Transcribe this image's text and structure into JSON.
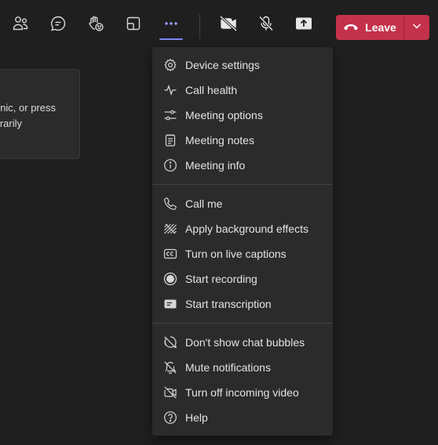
{
  "toolbar": {
    "buttons": [
      {
        "name": "people-icon"
      },
      {
        "name": "chat-icon"
      },
      {
        "name": "raise-hand-icon"
      },
      {
        "name": "view-icon"
      },
      {
        "name": "more-actions-icon",
        "active": true
      },
      {
        "name": "camera-off-icon"
      },
      {
        "name": "mic-off-icon"
      },
      {
        "name": "share-tray-icon"
      }
    ],
    "leave_label": "Leave",
    "accent_color": "#7f85f5",
    "leave_color": "#c4314b"
  },
  "notice": {
    "line1": "nic, or press",
    "line2": "orarily"
  },
  "menu": {
    "group1": [
      {
        "icon": "gear-icon",
        "label": "Device settings"
      },
      {
        "icon": "pulse-icon",
        "label": "Call health"
      },
      {
        "icon": "sliders-icon",
        "label": "Meeting options"
      },
      {
        "icon": "notes-icon",
        "label": "Meeting notes"
      },
      {
        "icon": "info-icon",
        "label": "Meeting info"
      }
    ],
    "group2": [
      {
        "icon": "phone-icon",
        "label": "Call me"
      },
      {
        "icon": "background-effects-icon",
        "label": "Apply background effects"
      },
      {
        "icon": "closed-captions-icon",
        "label": "Turn on live captions"
      },
      {
        "icon": "record-icon",
        "label": "Start recording"
      },
      {
        "icon": "transcription-icon",
        "label": "Start transcription"
      }
    ],
    "group3": [
      {
        "icon": "chat-bubbles-off-icon",
        "label": "Don't show chat bubbles"
      },
      {
        "icon": "bell-off-icon",
        "label": "Mute notifications"
      },
      {
        "icon": "video-off-icon",
        "label": "Turn off incoming video"
      },
      {
        "icon": "help-icon",
        "label": "Help"
      }
    ]
  }
}
